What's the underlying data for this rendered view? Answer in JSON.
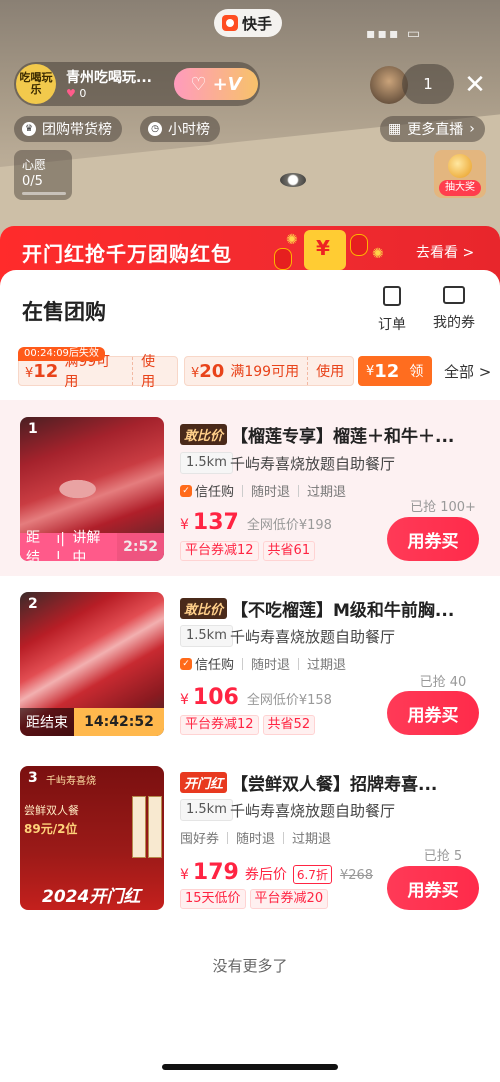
{
  "app": {
    "name": "快手"
  },
  "live": {
    "anchor_name": "青州吃喝玩...",
    "anchor_avatar_text": "吃喝玩乐",
    "likes": "0",
    "viewer_count": "1",
    "chips": [
      "团购带货榜",
      "小时榜",
      "更多直播"
    ],
    "wish_label": "心愿",
    "wish_progress": "0/5",
    "prize_label": "抽大奖"
  },
  "banner": {
    "title": "开门红抢千万团购红包",
    "link": "去看看 >"
  },
  "sheet": {
    "title": "在售团购",
    "actions": [
      "订单",
      "我的券"
    ],
    "coupon_expire": "00:24:09后失效",
    "coupons": [
      {
        "amount": "12",
        "cond": "满99可用",
        "use": "使用"
      },
      {
        "amount": "20",
        "cond": "满199可用",
        "use": "使用"
      },
      {
        "amount": "12",
        "cond": "领"
      }
    ],
    "all_label": "全部 >"
  },
  "products": [
    {
      "index": "1",
      "badge": "敢比价",
      "title": "【榴莲专享】榴莲＋和牛＋...",
      "distance": "1.5km",
      "shop": "千屿寿喜烧放题自助餐厅",
      "trust": "信任购",
      "policies": [
        "随时退",
        "过期退"
      ],
      "price": "137",
      "orig_price": "全网低价¥198",
      "tags": [
        "平台券减12",
        "共省61"
      ],
      "sold": "已抢 100+",
      "buy": "用券买",
      "live_left": "距结",
      "live_mid": "讲解中",
      "live_time": "2:52"
    },
    {
      "index": "2",
      "badge": "敢比价",
      "title": "【不吃榴莲】M级和牛前胸...",
      "distance": "1.5km",
      "shop": "千屿寿喜烧放题自助餐厅",
      "trust": "信任购",
      "policies": [
        "随时退",
        "过期退"
      ],
      "price": "106",
      "orig_price": "全网低价¥158",
      "tags": [
        "平台券减12",
        "共省52"
      ],
      "sold": "已抢 40",
      "buy": "用券买",
      "live_left": "距结束",
      "live_time": "14:42:52"
    },
    {
      "index": "3",
      "badge": "开门红",
      "title": "【尝鲜双人餐】招牌寿喜...",
      "distance": "1.5km",
      "shop": "千屿寿喜烧放题自助餐厅",
      "policies": [
        "囤好券",
        "随时退",
        "过期退"
      ],
      "price": "179",
      "after_label": "券后价",
      "discount": "6.7折",
      "orig_price": "¥268",
      "tags": [
        "15天低价",
        "平台券减20"
      ],
      "sold": "已抢 5",
      "buy": "用券买",
      "poster_title": "千屿寿喜烧",
      "poster_sub": "尝鲜双人餐",
      "poster_price": "89元/2位",
      "poster_year": "2024开门红"
    }
  ],
  "footer": {
    "no_more": "没有更多了"
  }
}
